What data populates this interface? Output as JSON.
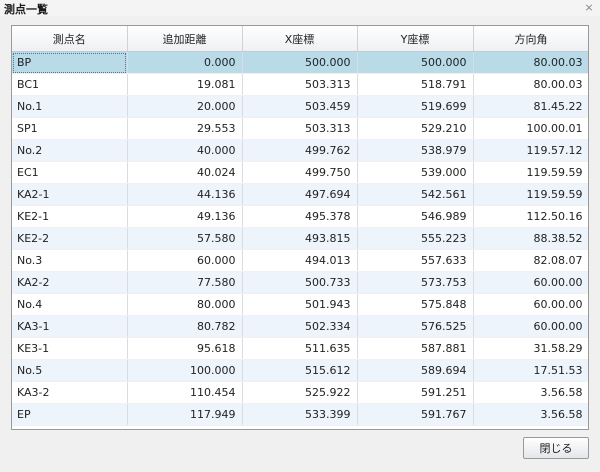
{
  "window": {
    "title": "測点一覧",
    "close_glyph": "⨯"
  },
  "table": {
    "headers": [
      "測点名",
      "追加距離",
      "X座標",
      "Y座標",
      "方向角"
    ],
    "rows": [
      [
        "BP",
        "0.000",
        "500.000",
        "500.000",
        "80.00.03"
      ],
      [
        "BC1",
        "19.081",
        "503.313",
        "518.791",
        "80.00.03"
      ],
      [
        "No.1",
        "20.000",
        "503.459",
        "519.699",
        "81.45.22"
      ],
      [
        "SP1",
        "29.553",
        "503.313",
        "529.210",
        "100.00.01"
      ],
      [
        "No.2",
        "40.000",
        "499.762",
        "538.979",
        "119.57.12"
      ],
      [
        "EC1",
        "40.024",
        "499.750",
        "539.000",
        "119.59.59"
      ],
      [
        "KA2-1",
        "44.136",
        "497.694",
        "542.561",
        "119.59.59"
      ],
      [
        "KE2-1",
        "49.136",
        "495.378",
        "546.989",
        "112.50.16"
      ],
      [
        "KE2-2",
        "57.580",
        "493.815",
        "555.223",
        "88.38.52"
      ],
      [
        "No.3",
        "60.000",
        "494.013",
        "557.633",
        "82.08.07"
      ],
      [
        "KA2-2",
        "77.580",
        "500.733",
        "573.753",
        "60.00.00"
      ],
      [
        "No.4",
        "80.000",
        "501.943",
        "575.848",
        "60.00.00"
      ],
      [
        "KA3-1",
        "80.782",
        "502.334",
        "576.525",
        "60.00.00"
      ],
      [
        "KE3-1",
        "95.618",
        "511.635",
        "587.881",
        "31.58.29"
      ],
      [
        "No.5",
        "100.000",
        "515.612",
        "589.694",
        "17.51.53"
      ],
      [
        "KA3-2",
        "110.454",
        "525.922",
        "591.251",
        "3.56.58"
      ],
      [
        "EP",
        "117.949",
        "533.399",
        "591.767",
        "3.56.58"
      ]
    ]
  },
  "footer": {
    "close_label": "閉じる"
  }
}
